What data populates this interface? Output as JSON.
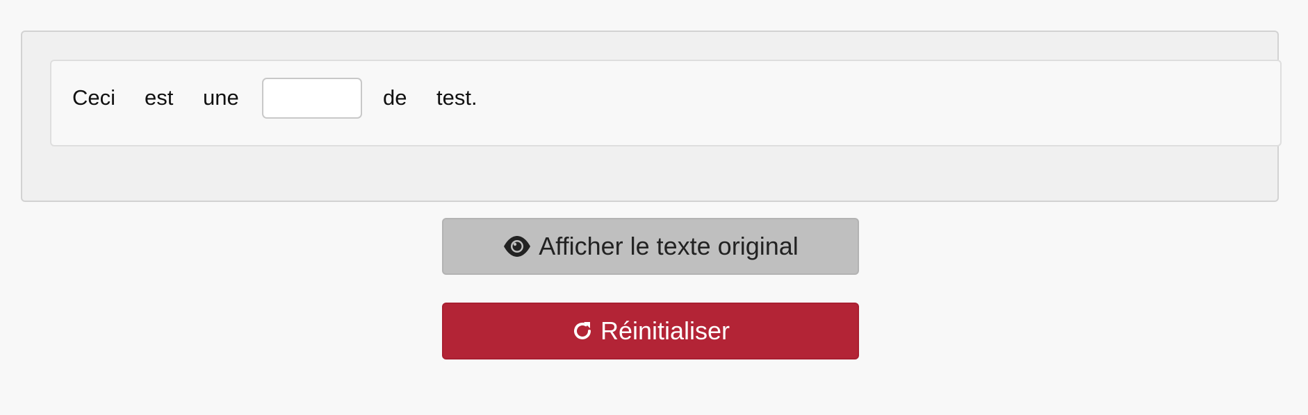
{
  "exercise": {
    "words_before": [
      "Ceci",
      "est",
      "une"
    ],
    "blank": {
      "value": "",
      "placeholder": ""
    },
    "words_after": [
      "de",
      "test."
    ]
  },
  "buttons": {
    "show_original": {
      "label": "Afficher le texte original",
      "icon": "eye-icon",
      "color": "#bfbfbf"
    },
    "reset": {
      "label": "Réinitialiser",
      "icon": "rotate-right-icon",
      "color": "#b32436"
    }
  }
}
